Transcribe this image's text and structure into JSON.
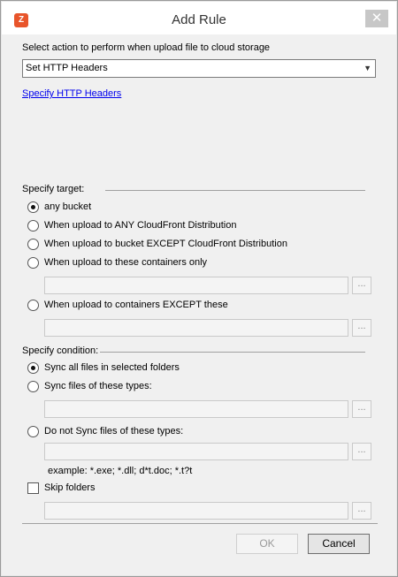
{
  "window": {
    "title": "Add Rule",
    "close_glyph": "✕",
    "app_icon": "app-icon"
  },
  "action": {
    "prompt": "Select action to perform when upload file to cloud storage",
    "selected": "Set HTTP Headers",
    "link": "Specify HTTP Headers"
  },
  "target": {
    "legend": "Specify target:",
    "options": [
      {
        "label": "any bucket",
        "checked": true
      },
      {
        "label": "When upload to ANY CloudFront Distribution",
        "checked": false
      },
      {
        "label": "When upload to bucket EXCEPT CloudFront Distribution",
        "checked": false
      },
      {
        "label": "When upload to these containers only",
        "checked": false
      },
      {
        "label": "When upload to containers EXCEPT these",
        "checked": false
      }
    ]
  },
  "condition": {
    "legend": "Specify condition:",
    "options": [
      {
        "label": "Sync all files in selected folders",
        "checked": true
      },
      {
        "label": "Sync files of these types:",
        "checked": false
      },
      {
        "label": "Do not Sync files of these types:",
        "checked": false
      }
    ],
    "example": "example: *.exe; *.dll; d*t.doc; *.t?t",
    "skip_folders": {
      "label": "Skip folders",
      "checked": false
    }
  },
  "browse_label": "...",
  "buttons": {
    "ok": "OK",
    "cancel": "Cancel"
  }
}
